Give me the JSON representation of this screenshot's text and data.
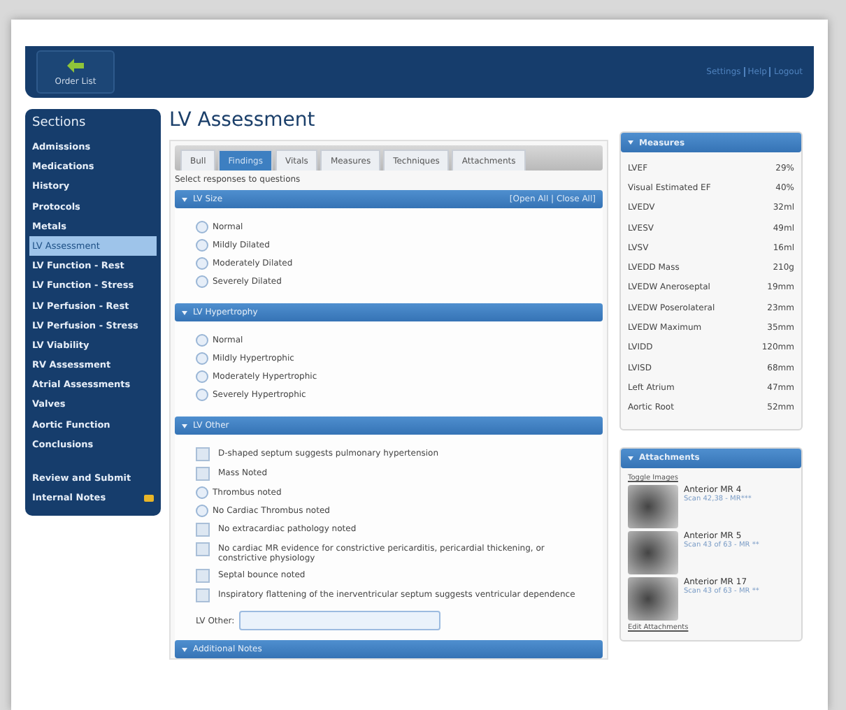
{
  "header": {
    "back_button": "Order List",
    "links": [
      "Settings",
      "Help",
      "Logout"
    ]
  },
  "sidebar": {
    "title": "Sections",
    "items": [
      {
        "label": "Admissions",
        "selected": false
      },
      {
        "label": "Medications",
        "selected": false
      },
      {
        "label": "History",
        "selected": false
      },
      {
        "label": "Protocols",
        "selected": false
      },
      {
        "label": "Metals",
        "selected": false
      },
      {
        "label": "LV Assessment",
        "selected": true
      },
      {
        "label": "LV Function - Rest",
        "selected": false
      },
      {
        "label": "LV Function - Stress",
        "selected": false
      },
      {
        "label": "LV Perfusion - Rest",
        "selected": false
      },
      {
        "label": "LV Perfusion - Stress",
        "selected": false
      },
      {
        "label": "LV Viability",
        "selected": false
      },
      {
        "label": "RV Assessment",
        "selected": false
      },
      {
        "label": "Atrial Assessments",
        "selected": false
      },
      {
        "label": "Valves",
        "selected": false
      },
      {
        "label": "Aortic Function",
        "selected": false
      },
      {
        "label": "Conclusions",
        "selected": false
      }
    ],
    "bottom_items": [
      {
        "label": "Review and Submit",
        "selected": false
      },
      {
        "label": "Internal Notes",
        "selected": false,
        "has_note": true
      }
    ]
  },
  "page_title": "LV Assessment",
  "tabs": [
    {
      "label": "Bull",
      "selected": false
    },
    {
      "label": "Findings",
      "selected": true
    },
    {
      "label": "Vitals",
      "selected": false
    },
    {
      "label": "Measures",
      "selected": false
    },
    {
      "label": "Techniques",
      "selected": false
    },
    {
      "label": "Attachments",
      "selected": false
    }
  ],
  "instructions": "Select responses to questions",
  "open_close": "[Open All | Close All]",
  "sections": [
    {
      "title": "LV Size",
      "expanded": true,
      "options": [
        {
          "kind": "radio",
          "label": "Normal",
          "checked": false
        },
        {
          "kind": "radio",
          "label": "Mildly Dilated",
          "checked": false
        },
        {
          "kind": "radio",
          "label": "Moderately Dilated",
          "checked": false
        },
        {
          "kind": "radio",
          "label": "Severely Dilated",
          "checked": false
        }
      ]
    },
    {
      "title": "LV Hypertrophy",
      "expanded": true,
      "options": [
        {
          "kind": "radio",
          "label": "Normal",
          "checked": false
        },
        {
          "kind": "radio",
          "label": "Mildly Hypertrophic",
          "checked": false
        },
        {
          "kind": "radio",
          "label": "Moderately Hypertrophic",
          "checked": false
        },
        {
          "kind": "radio",
          "label": "Severely Hypertrophic",
          "checked": false
        }
      ]
    },
    {
      "title": "LV Other",
      "expanded": true,
      "options": [
        {
          "kind": "checkbox",
          "label": "D-shaped septum suggests pulmonary hypertension",
          "checked": false
        },
        {
          "kind": "checkbox",
          "label": "Mass Noted",
          "checked": false
        },
        {
          "kind": "radio",
          "label": "Thrombus noted",
          "checked": false
        },
        {
          "kind": "radio",
          "label": "No Cardiac Thrombus noted",
          "checked": false
        },
        {
          "kind": "checkbox",
          "label": "No extracardiac pathology noted",
          "checked": false
        },
        {
          "kind": "checkbox",
          "label": "No cardiac MR evidence for constrictive pericarditis, pericardial thickening, or constrictive physiology",
          "checked": false
        },
        {
          "kind": "checkbox",
          "label": "Septal bounce noted",
          "checked": false
        },
        {
          "kind": "checkbox",
          "label": "Inspiratory flattening of the inerventricular septum suggests ventricular dependence",
          "checked": false
        }
      ],
      "field": {
        "label": "LV Other:"
      }
    },
    {
      "title": "Additional Notes",
      "expanded": true
    }
  ],
  "measures": {
    "title": "Measures",
    "rows": [
      {
        "name": "LVEF",
        "value": "29%"
      },
      {
        "name": "Visual Estimated EF",
        "value": "40%"
      },
      {
        "name": "LVEDV",
        "value": "32ml"
      },
      {
        "name": "LVESV",
        "value": "49ml"
      },
      {
        "name": "LVSV",
        "value": "16ml"
      },
      {
        "name": "LVEDD Mass",
        "value": "210g"
      },
      {
        "name": "LVEDW Aneroseptal",
        "value": "19mm"
      },
      {
        "name": "LVEDW Poserolateral",
        "value": "23mm"
      },
      {
        "name": "LVEDW Maximum",
        "value": "35mm"
      },
      {
        "name": "LVIDD",
        "value": "120mm"
      },
      {
        "name": "LVISD",
        "value": "68mm"
      },
      {
        "name": "Left Atrium",
        "value": "47mm"
      },
      {
        "name": "Aortic Root",
        "value": "52mm"
      }
    ]
  },
  "attachments": {
    "title": "Attachments",
    "toggle": "Toggle Images",
    "items": [
      {
        "name": "Anterior MR 4",
        "detail": "Scan 42,38 - MR***"
      },
      {
        "name": "Anterior MR 5",
        "detail": "Scan 43 of 63 - MR **"
      },
      {
        "name": "Anterior MR 17",
        "detail": "Scan 43 of 63 - MR **"
      }
    ],
    "edit": "Edit Attachments"
  }
}
